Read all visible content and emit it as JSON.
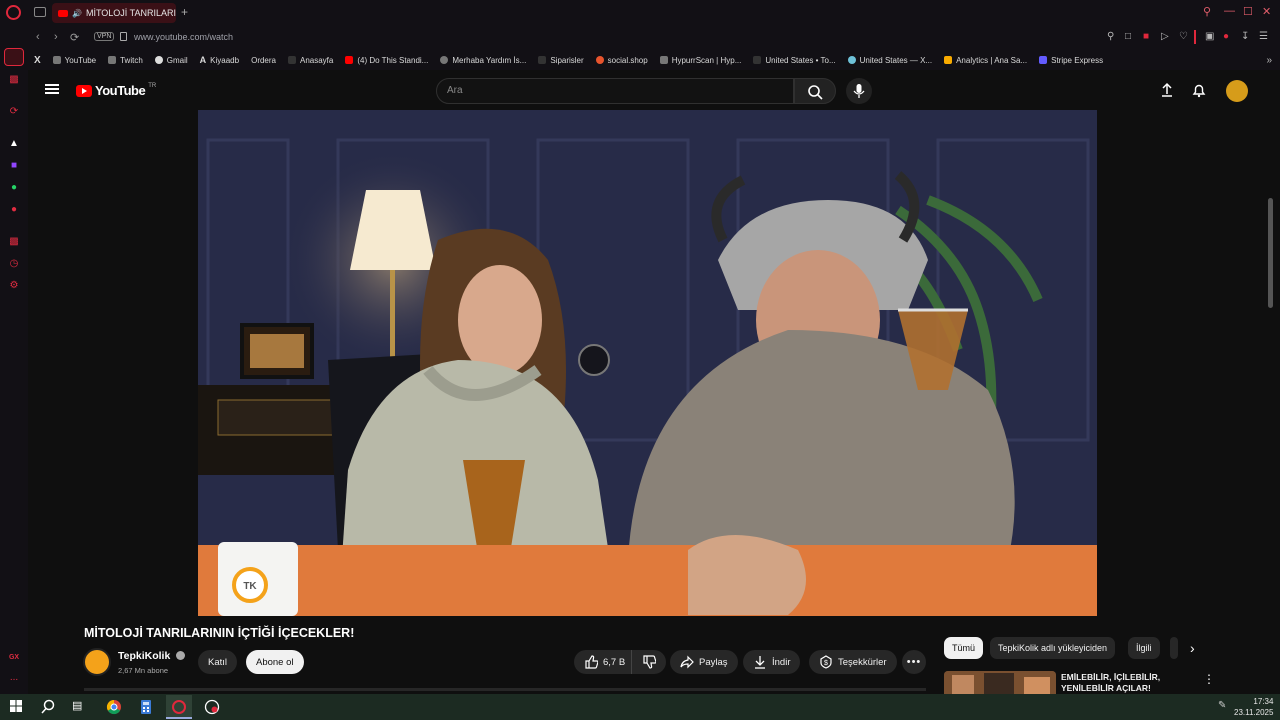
{
  "browser": {
    "tab_title": "MİTOLOJİ TANRILARIN",
    "url": "www.youtube.com/watch",
    "vpn_label": "VPN",
    "accent": "#e0283c"
  },
  "bookmarks": [
    {
      "label": "YouTube"
    },
    {
      "label": "Twitch"
    },
    {
      "label": "Gmail"
    },
    {
      "label": "Kiyaadb"
    },
    {
      "label": "Ordera"
    },
    {
      "label": "Anasayfa"
    },
    {
      "label": "(4) Do This Standi..."
    },
    {
      "label": "Merhaba Yardım İs..."
    },
    {
      "label": "Siparisler"
    },
    {
      "label": "social.shop"
    },
    {
      "label": "HypurrScan | Hyp..."
    },
    {
      "label": "United States • To..."
    },
    {
      "label": "United States — X..."
    },
    {
      "label": "Analytics | Ana Sa..."
    },
    {
      "label": "Stripe Express"
    }
  ],
  "sidebar": {
    "gx_label": "GX",
    "more_label": "..."
  },
  "youtube": {
    "logo_text": "YouTube",
    "country": "TR",
    "search_placeholder": "Ara"
  },
  "video": {
    "title": "MİTOLOJİ TANRILARININ İÇTİĞİ İÇECEKLER!",
    "channel_name": "TepkiKolik",
    "subscribers": "2,67 Mn abone",
    "join_label": "Katıl",
    "subscribe_label": "Abone ol",
    "likes": "6,7 B",
    "share_label": "Paylaş",
    "download_label": "İndir",
    "thanks_label": "Teşekkürler",
    "mug_logo": "TK"
  },
  "filters": {
    "chips": [
      "Tümü",
      "TepkiKolik adlı yükleyiciden",
      "İlgili"
    ]
  },
  "recommendation": {
    "title": "EMİLEBİLİR, İÇİLEBİLİR, YENİLEBİLİR AÇILAR!"
  },
  "taskbar": {
    "time": "17:34",
    "date": "23.11.2025"
  }
}
